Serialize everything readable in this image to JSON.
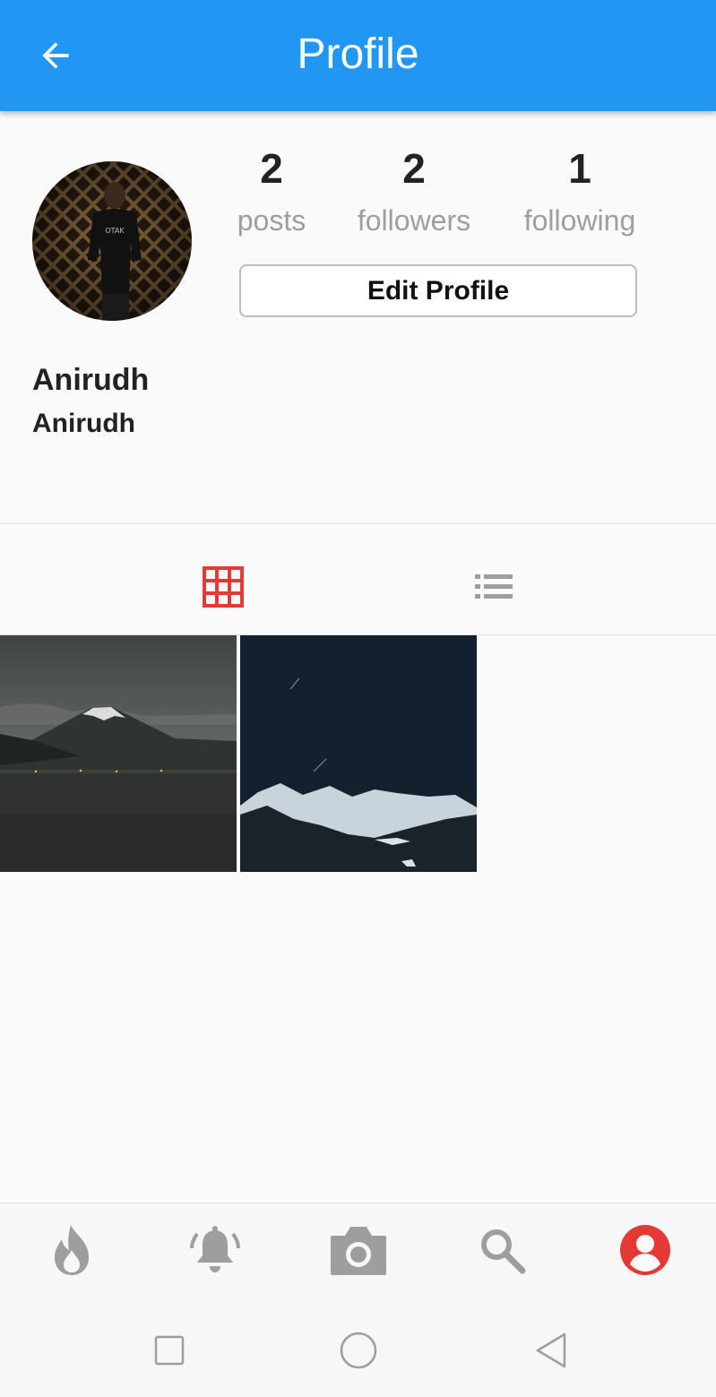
{
  "appbar": {
    "title": "Profile",
    "back_icon": "arrow-back-icon"
  },
  "colors": {
    "primary": "#2196f3",
    "accent": "#e53935",
    "inactive": "#9e9e9e"
  },
  "profile": {
    "name": "Anirudh",
    "username": "Anirudh",
    "stats": [
      {
        "value": "2",
        "label": "posts"
      },
      {
        "value": "2",
        "label": "followers"
      },
      {
        "value": "1",
        "label": "following"
      }
    ],
    "edit_button": "Edit Profile"
  },
  "view_tabs": [
    {
      "icon": "grid-icon",
      "active": true
    },
    {
      "icon": "list-icon",
      "active": false
    }
  ],
  "posts": [
    {
      "subject": "mountain-lake-photo"
    },
    {
      "subject": "snowy-mountains-night-photo"
    }
  ],
  "bottom_nav": [
    {
      "icon": "flame-icon",
      "active": false
    },
    {
      "icon": "bell-icon",
      "active": false
    },
    {
      "icon": "camera-icon",
      "active": false
    },
    {
      "icon": "search-icon",
      "active": false
    },
    {
      "icon": "account-icon",
      "active": true
    }
  ],
  "system_nav": [
    "recents-icon",
    "home-icon",
    "back-icon"
  ]
}
